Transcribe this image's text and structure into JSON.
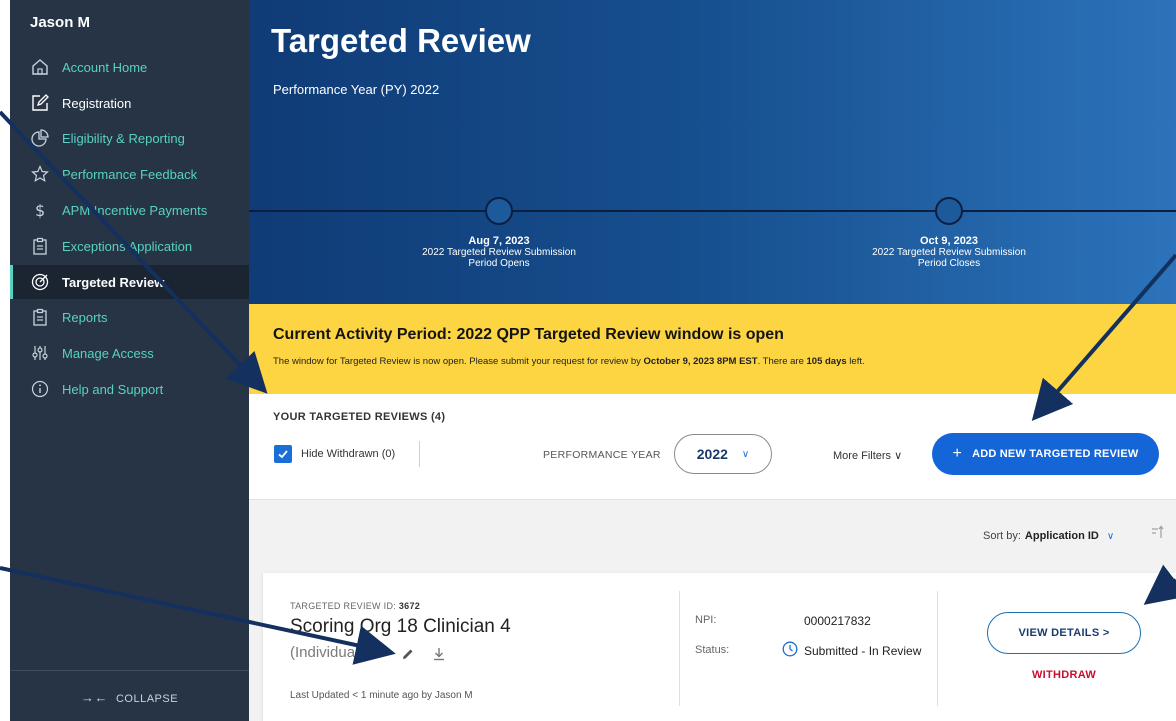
{
  "sidebar": {
    "user_name": "Jason M",
    "items": [
      {
        "label": "Account Home",
        "icon": "home-icon"
      },
      {
        "label": "Registration",
        "icon": "edit-square-icon"
      },
      {
        "label": "Eligibility & Reporting",
        "icon": "pie-chart-icon"
      },
      {
        "label": "Performance Feedback",
        "icon": "star-icon"
      },
      {
        "label": "APM Incentive Payments",
        "icon": "dollar-icon"
      },
      {
        "label": "Exceptions Application",
        "icon": "clipboard-icon"
      },
      {
        "label": "Targeted Review",
        "icon": "target-icon"
      },
      {
        "label": "Reports",
        "icon": "clipboard-icon"
      },
      {
        "label": "Manage Access",
        "icon": "sliders-icon"
      },
      {
        "label": "Help and Support",
        "icon": "info-icon"
      }
    ],
    "collapse_label": "COLLAPSE",
    "accent_color": "#59d1c4"
  },
  "hero": {
    "title": "Targeted Review",
    "subtitle": "Performance Year (PY) 2022",
    "timeline": [
      {
        "date": "Aug 7, 2023",
        "line1": "2022 Targeted Review Submission",
        "line2": "Period Opens"
      },
      {
        "date": "Oct 9, 2023",
        "line1": "2022 Targeted Review Submission",
        "line2": "Period Closes"
      }
    ]
  },
  "alert": {
    "title": "Current Activity Period: 2022 QPP Targeted Review window is open",
    "text_pre": "The window for Targeted Review is now open. Please submit your request for review by ",
    "deadline": "October 9, 2023 8PM EST",
    "text_mid": ". There are ",
    "days_left": "105 days",
    "text_post": " left.",
    "color": "#fdd542"
  },
  "list": {
    "heading": "YOUR TARGETED REVIEWS (4)",
    "hide_withdrawn_label": "Hide Withdrawn (0)",
    "performance_year_label": "PERFORMANCE YEAR",
    "performance_year_value": "2022",
    "more_filters_label": "More Filters",
    "add_button_label": "ADD NEW TARGETED REVIEW",
    "sort_label": "Sort by:",
    "sort_value": "Application ID"
  },
  "card": {
    "id_label": "TARGETED REVIEW ID:",
    "id_value": "3672",
    "name": "Scoring Org 18 Clinician 4",
    "type": "(Individual)",
    "updated": "Last Updated < 1 minute ago by Jason M",
    "npi_label": "NPI:",
    "npi_value": "0000217832",
    "status_label": "Status:",
    "status_value": "Submitted - In Review",
    "view_details_label": "VIEW DETAILS >",
    "withdraw_label": "WITHDRAW"
  }
}
